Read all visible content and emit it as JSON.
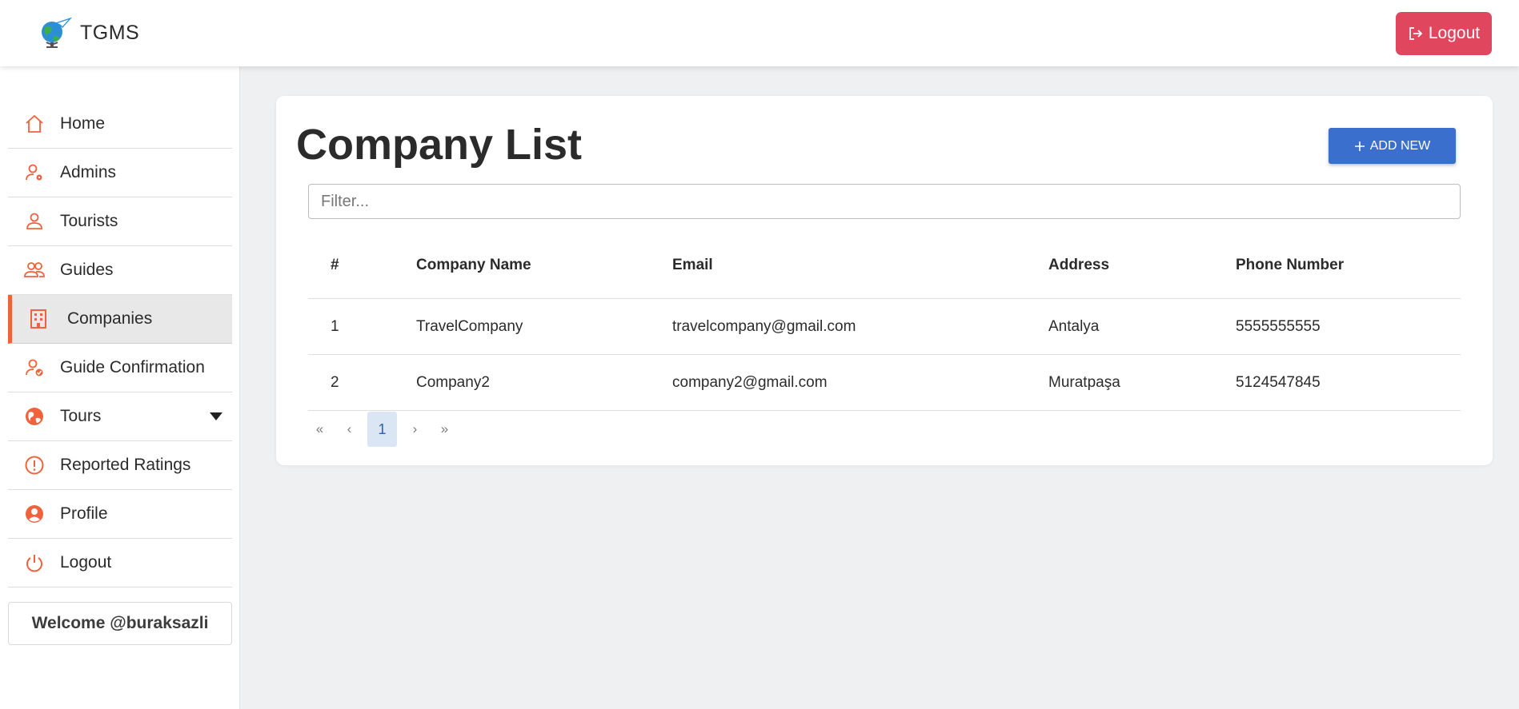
{
  "header": {
    "app_name": "TGMS",
    "logout_label": "Logout"
  },
  "sidebar": {
    "items": [
      {
        "label": "Home",
        "icon": "home-icon"
      },
      {
        "label": "Admins",
        "icon": "user-gear-icon"
      },
      {
        "label": "Tourists",
        "icon": "user-icon"
      },
      {
        "label": "Guides",
        "icon": "users-icon"
      },
      {
        "label": "Companies",
        "icon": "building-icon",
        "active": true
      },
      {
        "label": "Guide Confirmation",
        "icon": "user-check-icon"
      },
      {
        "label": "Tours",
        "icon": "globe-icon",
        "has_dropdown": true
      },
      {
        "label": "Reported Ratings",
        "icon": "alert-circle-icon"
      },
      {
        "label": "Profile",
        "icon": "user-circle-icon"
      },
      {
        "label": "Logout",
        "icon": "power-icon"
      }
    ],
    "welcome": "Welcome @buraksazli",
    "accent_color": "#f0623c"
  },
  "main": {
    "title": "Company List",
    "add_button_label": "ADD NEW",
    "filter_placeholder": "Filter...",
    "table": {
      "columns": [
        "#",
        "Company Name",
        "Email",
        "Address",
        "Phone Number"
      ],
      "rows": [
        [
          "1",
          "TravelCompany",
          "travelcompany@gmail.com",
          "Antalya",
          "5555555555"
        ],
        [
          "2",
          "Company2",
          "company2@gmail.com",
          "Muratpaşa",
          "5124547845"
        ]
      ]
    },
    "pagination": {
      "first": "«",
      "prev": "‹",
      "current": "1",
      "next": "›",
      "last": "»"
    }
  },
  "colors": {
    "logout_button": "#e0475f",
    "add_button": "#3a6fce",
    "background": "#eff0f2"
  }
}
